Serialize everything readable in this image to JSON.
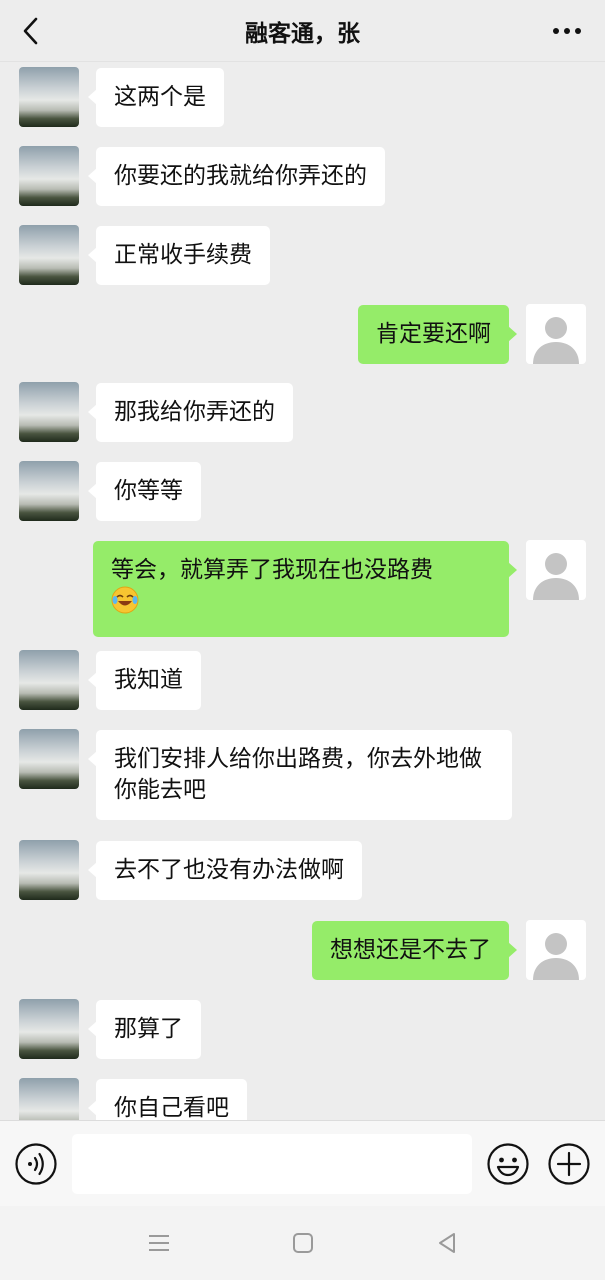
{
  "header": {
    "title": "融客通，张"
  },
  "messages": [
    {
      "side": "in",
      "text": "这两个是"
    },
    {
      "side": "in",
      "text": "你要还的我就给你弄还的"
    },
    {
      "side": "in",
      "text": "正常收手续费"
    },
    {
      "side": "out",
      "text": "肯定要还啊"
    },
    {
      "side": "in",
      "text": "那我给你弄还的"
    },
    {
      "side": "in",
      "text": "你等等"
    },
    {
      "side": "out",
      "text": "等会，就算弄了我现在也没路费",
      "emoji": "laughing-crying-emoji"
    },
    {
      "side": "in",
      "text": "我知道"
    },
    {
      "side": "in",
      "text": "我们安排人给你出路费，你去外地做你能去吧"
    },
    {
      "side": "in",
      "text": "去不了也没有办法做啊"
    },
    {
      "side": "out",
      "text": "想想还是不去了"
    },
    {
      "side": "in",
      "text": "那算了"
    },
    {
      "side": "in",
      "text": "你自己看吧"
    }
  ],
  "input": {
    "value": "",
    "placeholder": ""
  },
  "colors": {
    "background": "#ededed",
    "incoming_bubble": "#ffffff",
    "outgoing_bubble": "#95ec69"
  },
  "icons": {
    "back": "chevron-left-icon",
    "more": "more-dots-icon",
    "voice": "voice-icon",
    "emoji": "emoji-icon",
    "plus": "plus-icon",
    "nav_menu": "menu-icon",
    "nav_home": "home-square-icon",
    "nav_back": "back-triangle-icon"
  }
}
